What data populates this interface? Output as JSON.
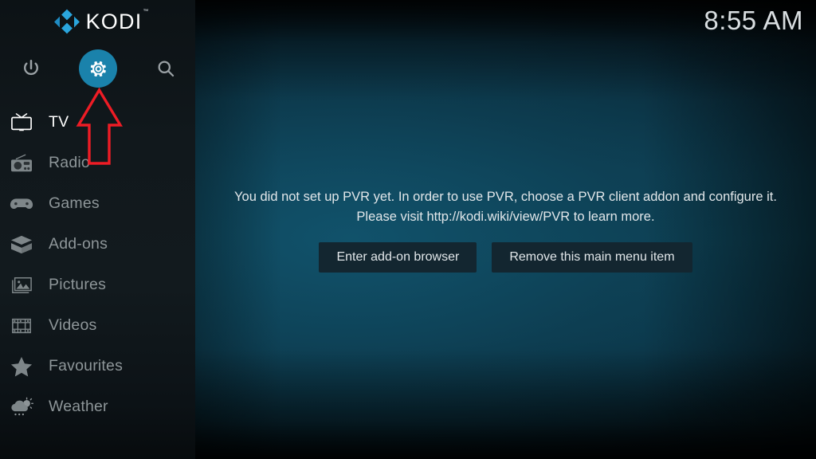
{
  "app": {
    "name": "KODI",
    "trademark": "™",
    "logo_color": "#2aa5dc"
  },
  "clock": {
    "time": "8:55 AM"
  },
  "top_icons": [
    {
      "name": "power-icon",
      "label": "Power"
    },
    {
      "name": "settings-icon",
      "label": "Settings",
      "active": true,
      "accent": "#1a82ab"
    },
    {
      "name": "search-icon",
      "label": "Search"
    }
  ],
  "sidebar": {
    "background": "#111a1e",
    "items": [
      {
        "label": "TV",
        "icon": "tv-icon",
        "selected": true
      },
      {
        "label": "Radio",
        "icon": "radio-icon",
        "selected": false
      },
      {
        "label": "Games",
        "icon": "gamepad-icon",
        "selected": false
      },
      {
        "label": "Add-ons",
        "icon": "open-box-icon",
        "selected": false
      },
      {
        "label": "Pictures",
        "icon": "pictures-icon",
        "selected": false
      },
      {
        "label": "Videos",
        "icon": "film-strip-icon",
        "selected": false
      },
      {
        "label": "Favourites",
        "icon": "star-icon",
        "selected": false
      },
      {
        "label": "Weather",
        "icon": "cloud-sun-rain-icon",
        "selected": false
      }
    ]
  },
  "main": {
    "message_line1": "You did not set up PVR yet. In order to use PVR, choose a PVR client addon and configure it.",
    "message_line2": "Please visit http://kodi.wiki/view/PVR to learn more.",
    "buttons": [
      {
        "label": "Enter add-on browser"
      },
      {
        "label": "Remove this main menu item"
      }
    ]
  },
  "annotation": {
    "type": "arrow",
    "direction": "up",
    "color": "#ee1c25",
    "points_to": "settings-icon"
  }
}
